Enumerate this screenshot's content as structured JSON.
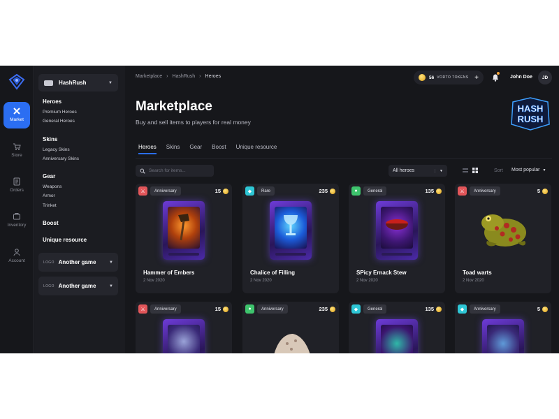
{
  "rail": {
    "items": [
      {
        "label": "Market",
        "icon": "crossed-swords-icon"
      },
      {
        "label": "Store",
        "icon": "cart-icon"
      },
      {
        "label": "Orders",
        "icon": "orders-icon"
      },
      {
        "label": "Inventory",
        "icon": "inventory-icon"
      },
      {
        "label": "Account",
        "icon": "user-icon"
      }
    ]
  },
  "categories": {
    "game": "HashRush",
    "sections": [
      {
        "title": "Heroes",
        "items": [
          "Premium Heroes",
          "General Heroes"
        ]
      },
      {
        "title": "Skins",
        "items": [
          "Legacy Skins",
          "Anniversary Skins"
        ]
      },
      {
        "title": "Gear",
        "items": [
          "Weapons",
          "Armor",
          "Trinket"
        ]
      },
      {
        "title": "Boost",
        "items": []
      },
      {
        "title": "Unique resource",
        "items": []
      }
    ],
    "other_games": [
      {
        "logo": "LOGO",
        "name": "Another game"
      },
      {
        "logo": "LOGO",
        "name": "Another game"
      }
    ]
  },
  "header": {
    "breadcrumb": [
      "Marketplace",
      "HashRush",
      "Heroes"
    ],
    "tokens_value": "56",
    "tokens_label": "VORTO TOKENS",
    "tokens_add": "+",
    "user_name": "John Doe",
    "user_initials": "JD"
  },
  "page": {
    "title": "Marketplace",
    "subtitle": "Buy and sell items to players for real money",
    "brand_line1": "HASH",
    "brand_line2": "RUSH"
  },
  "tabs": [
    "Heroes",
    "Skins",
    "Gear",
    "Boost",
    "Unique resource"
  ],
  "toolbar": {
    "search_placeholder": "Search for items...",
    "filter_value": "All heroes",
    "sort_label": "Sort",
    "sort_value": "Most popular"
  },
  "cards": [
    {
      "badge": "Anniversary",
      "price": "15",
      "name": "Hammer of Embers",
      "date": "2 Nov 2020",
      "tag_color": "#e2565a",
      "icon": "sword-icon"
    },
    {
      "badge": "Rare",
      "price": "235",
      "name": "Chalice of Filling",
      "date": "2 Nov 2020",
      "tag_color": "#2ec7d6",
      "icon": "shield-icon"
    },
    {
      "badge": "General",
      "price": "135",
      "name": "SPicy Ernack Stew",
      "date": "2 Nov 2020",
      "tag_color": "#3ec46d",
      "icon": "potion-icon"
    },
    {
      "badge": "Anniversary",
      "price": "5",
      "name": "Toad warts",
      "date": "2 Nov 2020",
      "tag_color": "#e2565a",
      "icon": "sword-icon"
    },
    {
      "badge": "Anniversary",
      "price": "15",
      "name": "",
      "date": "",
      "tag_color": "#e2565a",
      "icon": "sword-icon"
    },
    {
      "badge": "Anniversary",
      "price": "235",
      "name": "",
      "date": "",
      "tag_color": "#3ec46d",
      "icon": "potion-icon"
    },
    {
      "badge": "General",
      "price": "135",
      "name": "",
      "date": "",
      "tag_color": "#2ec7d6",
      "icon": "shield-icon"
    },
    {
      "badge": "Anniversary",
      "price": "5",
      "name": "",
      "date": "",
      "tag_color": "#2ec7d6",
      "icon": "shield-icon"
    }
  ],
  "colors": {
    "accent": "#2b6ef2",
    "background": "#16171b",
    "card": "#202127"
  }
}
